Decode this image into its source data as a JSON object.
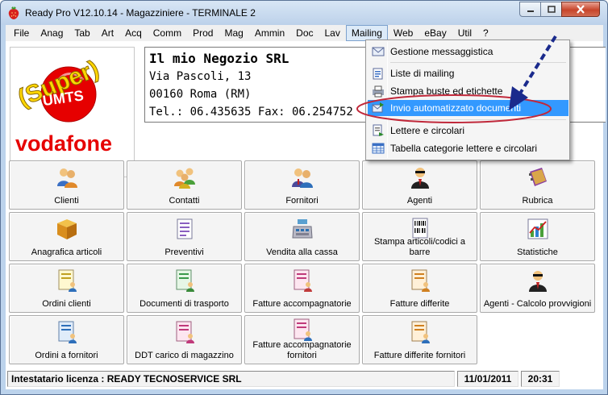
{
  "window": {
    "title": "Ready Pro V12.10.14 - Magazziniere - TERMINALE 2",
    "controls": [
      "minimize",
      "maximize",
      "close"
    ]
  },
  "menubar": {
    "items": [
      "File",
      "Anag",
      "Tab",
      "Art",
      "Acq",
      "Comm",
      "Prod",
      "Mag",
      "Ammin",
      "Doc",
      "Lav",
      "Mailing",
      "Web",
      "eBay",
      "Util",
      "?"
    ],
    "active": "Mailing"
  },
  "logo": {
    "super_text": "(Super)",
    "umts_text": "UMTS",
    "brand_text": "vodafone"
  },
  "company": {
    "name": "Il mio Negozio SRL",
    "address": "Via Pascoli, 13",
    "city": "00160 Roma (RM)",
    "phones": "Tel.: 06.435635 Fax: 06.254752"
  },
  "tiles": [
    {
      "label": "Clienti",
      "icon": "users-icon"
    },
    {
      "label": "Contatti",
      "icon": "contacts-icon"
    },
    {
      "label": "Fornitori",
      "icon": "suppliers-icon"
    },
    {
      "label": "Agenti",
      "icon": "agent-icon"
    },
    {
      "label": "Rubrica",
      "icon": "address-book-icon"
    },
    {
      "label": "Anagrafica articoli",
      "icon": "box-icon"
    },
    {
      "label": "Preventivi",
      "icon": "document-icon"
    },
    {
      "label": "Vendita alla cassa",
      "icon": "cash-register-icon"
    },
    {
      "label": "Stampa articoli/codici a barre",
      "icon": "barcode-icon"
    },
    {
      "label": "Statistiche",
      "icon": "chart-icon"
    },
    {
      "label": "Ordini clienti",
      "icon": "document-users-icon"
    },
    {
      "label": "Documenti di trasporto",
      "icon": "document-transport-icon"
    },
    {
      "label": "Fatture accompagnatorie",
      "icon": "document-invoice-icon"
    },
    {
      "label": "Fatture differite",
      "icon": "document-deferred-icon"
    },
    {
      "label": "Agenti - Calcolo provvigioni",
      "icon": "agent-icon"
    },
    {
      "label": "Ordini a fornitori",
      "icon": "document-supplier-icon"
    },
    {
      "label": "DDT carico di magazzino",
      "icon": "document-warehouse-icon"
    },
    {
      "label": "Fatture accompagnatorie fornitori",
      "icon": "document-invoice-icon"
    },
    {
      "label": "Fatture differite fornitori",
      "icon": "document-deferred-icon"
    }
  ],
  "mailing_menu": {
    "items": [
      {
        "label": "Gestione messaggistica",
        "icon": "messages-icon"
      },
      {
        "label": "Liste di mailing",
        "icon": "mailing-list-icon"
      },
      {
        "label": "Stampa buste ed etichette",
        "icon": "print-envelope-icon"
      },
      {
        "label": "Invio automatizzato documenti",
        "icon": "auto-send-icon",
        "highlighted": true
      },
      {
        "label": "Lettere e circolari",
        "icon": "letters-icon"
      },
      {
        "label": "Tabella categorie lettere e circolari",
        "icon": "table-icon"
      }
    ]
  },
  "statusbar": {
    "license": "Intestatario licenza : READY TECNOSERVICE SRL",
    "date": "11/01/2011",
    "time": "20:31"
  },
  "colors": {
    "highlight": "#3399ff",
    "annotation_ellipse": "#c0283a",
    "annotation_arrow": "#1a2a8c",
    "vodafone_red": "#e60000",
    "super_yellow": "#ffd700"
  }
}
